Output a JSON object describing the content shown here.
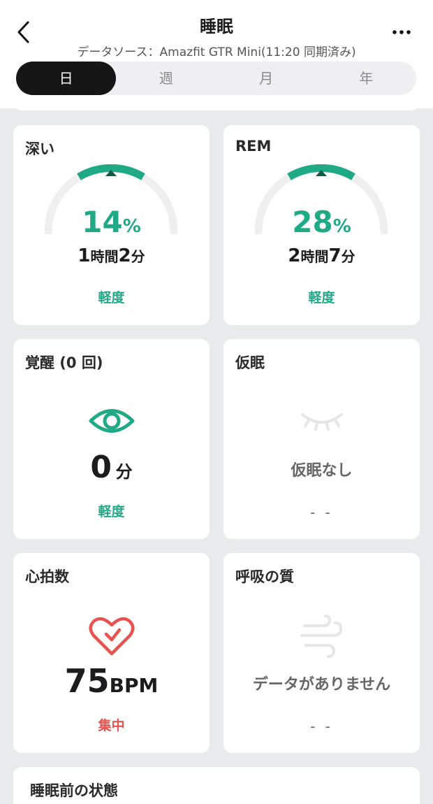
{
  "header": {
    "title": "睡眠",
    "subtitle": "データソース：Amazfit GTR Mini(11:20 同期済み)",
    "back_icon": "chevron-left-icon",
    "more_icon": "more-dots-icon"
  },
  "tabs": [
    {
      "label": "日",
      "active": true
    },
    {
      "label": "週",
      "active": false
    },
    {
      "label": "月",
      "active": false
    },
    {
      "label": "年",
      "active": false
    }
  ],
  "cards": {
    "deep": {
      "title": "深い",
      "percent": "14",
      "percent_unit": "%",
      "duration_h": "1",
      "unit_h": "時間",
      "duration_m": "2",
      "unit_m": "分",
      "level": "軽度",
      "marker_fraction": 0.5
    },
    "rem": {
      "title": "REM",
      "percent": "28",
      "percent_unit": "%",
      "duration_h": "2",
      "unit_h": "時間",
      "duration_m": "7",
      "unit_m": "分",
      "level": "軽度",
      "marker_fraction": 0.5
    },
    "awake": {
      "title": "覚醒 (0 回)",
      "value": "0",
      "unit": "分",
      "level": "軽度",
      "icon": "eye-icon"
    },
    "nap": {
      "title": "仮眠",
      "message": "仮眠なし",
      "dash": "- -",
      "icon": "closed-eye-icon"
    },
    "heart": {
      "title": "心拍数",
      "value": "75",
      "unit": "BPM",
      "level": "集中",
      "icon": "heart-icon"
    },
    "breath": {
      "title": "呼吸の質",
      "message": "データがありません",
      "dash": "- -",
      "icon": "wind-icon"
    }
  },
  "bottom": {
    "title": "睡眠前の状態"
  },
  "colors": {
    "accent": "#1faa85",
    "alert": "#e8534f",
    "track": "#efefef"
  }
}
